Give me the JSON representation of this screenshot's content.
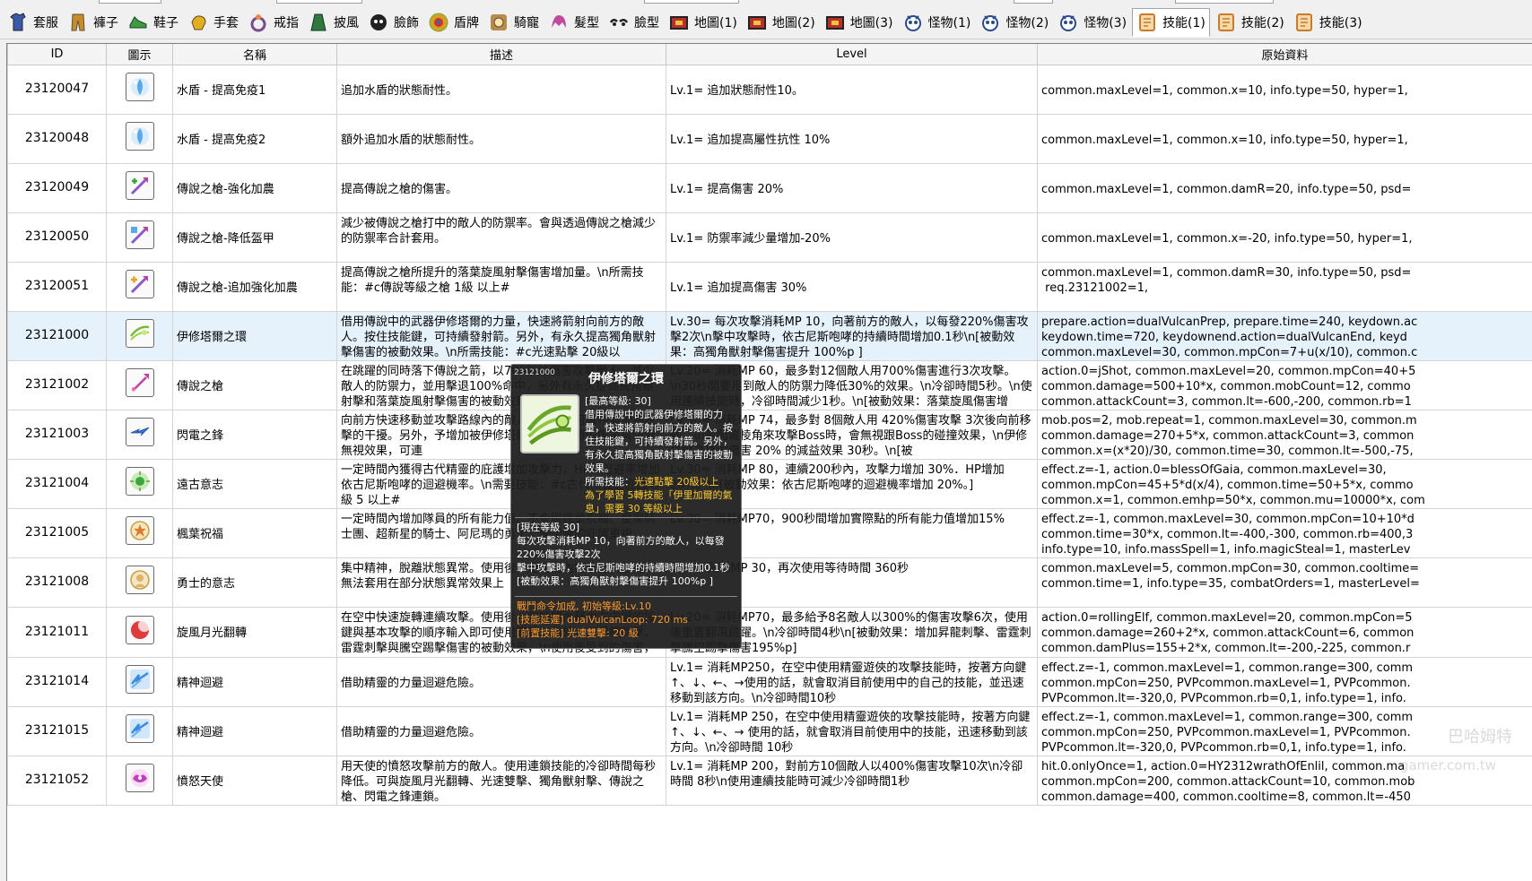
{
  "tabs": [
    {
      "label": "套服",
      "icon": "outfit-icon",
      "color": "#3a5aa8"
    },
    {
      "label": "褲子",
      "icon": "pants-icon",
      "color": "#c98b2a"
    },
    {
      "label": "鞋子",
      "icon": "shoes-icon",
      "color": "#3f9a3a"
    },
    {
      "label": "手套",
      "icon": "gloves-icon",
      "color": "#e0b020"
    },
    {
      "label": "戒指",
      "icon": "ring-icon",
      "color": "#7a4a8c"
    },
    {
      "label": "披風",
      "icon": "cape-icon",
      "color": "#2e7a3e"
    },
    {
      "label": "臉飾",
      "icon": "face-accessory-icon",
      "color": "#222222"
    },
    {
      "label": "盾牌",
      "icon": "shield-icon",
      "color": "#d4a020"
    },
    {
      "label": "騎寵",
      "icon": "mount-icon",
      "color": "#b78c4a"
    },
    {
      "label": "髮型",
      "icon": "hair-icon",
      "color": "#c04aa0"
    },
    {
      "label": "臉型",
      "icon": "face-icon",
      "color": "#222222"
    },
    {
      "label": "地圖(1)",
      "icon": "map-icon",
      "color": "#b8302a"
    },
    {
      "label": "地圖(2)",
      "icon": "map-icon",
      "color": "#b8302a"
    },
    {
      "label": "地圖(3)",
      "icon": "map-icon",
      "color": "#b8302a"
    },
    {
      "label": "怪物(1)",
      "icon": "monster-icon",
      "color": "#2a4a8c"
    },
    {
      "label": "怪物(2)",
      "icon": "monster-icon",
      "color": "#2a4a8c"
    },
    {
      "label": "怪物(3)",
      "icon": "monster-icon",
      "color": "#2a4a8c"
    },
    {
      "label": "技能(1)",
      "icon": "skill-book-icon",
      "color": "#c97a2a"
    },
    {
      "label": "技能(2)",
      "icon": "skill-book-icon",
      "color": "#c97a2a"
    },
    {
      "label": "技能(3)",
      "icon": "skill-book-icon",
      "color": "#c97a2a"
    }
  ],
  "active_tab": 17,
  "columns": [
    "ID",
    "圖示",
    "名稱",
    "描述",
    "Level",
    "原始資料"
  ],
  "rows": [
    {
      "id": "23120047",
      "icon": "water-shield-icon",
      "color": "#5aa8e8",
      "name": "水盾 - 提高免疫1",
      "desc": "追加水盾的狀態耐性。",
      "level": "Lv.1= 追加狀態耐性10。",
      "raw": "common.maxLevel=1, common.x=10, info.type=50, hyper=1,"
    },
    {
      "id": "23120048",
      "icon": "water-shield-icon",
      "color": "#5aa8e8",
      "name": "水盾 - 提高免疫2",
      "desc": "額外追加水盾的狀態耐性。",
      "level": "Lv.1= 追加提高屬性抗性 10%",
      "raw": "common.maxLevel=1, common.x=10, info.type=50, hyper=1,"
    },
    {
      "id": "23120049",
      "icon": "spear-enhance-icon",
      "color": "#8a5ac8",
      "name": "傳說之槍-強化加農",
      "desc": "提高傳說之槍的傷害。",
      "level": "Lv.1= 提高傷害 20%",
      "raw": "common.maxLevel=1, common.damR=20, info.type=50, psd="
    },
    {
      "id": "23120050",
      "icon": "spear-defense-icon",
      "color": "#8a5ac8",
      "name": "傳說之槍-降低盔甲",
      "desc": "減少被傳說之槍打中的敵人的防禦率。會與透過傳說之槍減少的防禦率合計套用。",
      "level": "Lv.1= 防禦率減少量增加-20%",
      "raw": "common.maxLevel=1, common.x=-20, info.type=50, hyper=1,"
    },
    {
      "id": "23120051",
      "icon": "spear-reinforce-icon",
      "color": "#8a5ac8",
      "name": "傳說之槍-追加強化加農",
      "desc": "提高傳說之槍所提升的落葉旋風射擊傷害增加量。\\n所需技能：#c傳說等級之槍 1級 以上#",
      "level": "Lv.1= 追加提高傷害 30%",
      "raw": "common.maxLevel=1, common.damR=30, info.type=50, psd=\n req.23121002=1,"
    },
    {
      "id": "23121000",
      "icon": "ishtar-ring-icon",
      "color": "#7ab838",
      "name": "伊修塔爾之環",
      "selected": true,
      "desc": "借用傳說中的武器伊修塔爾的力量，快速將箭射向前方的敵人。按住技能鍵，可持續發射箭。另外，有永久提高獨角獸射擊傷害的被動效果。\\n所需技能：#c光速點擊 20級以",
      "level": "Lv.30= 每次攻擊消耗MP 10，向著前方的敵人，以每發220%傷害攻擊2次\\n擊中攻擊時，依古尼斯咆哮的持續時間增加0.1秒\\n[被動效果：高獨角獸射擊傷害提升 100%p ]",
      "raw": "prepare.action=dualVulcanPrep, prepare.time=240, keydown.ac\nkeydown.time=720, keydownend.action=dualVulcanEnd, keyd\ncommon.maxLevel=30, common.mpCon=7+u(x/10), common.c"
    },
    {
      "id": "23121002",
      "icon": "legendary-spear-icon",
      "color": "#c040a0",
      "name": "傳說之槍",
      "desc": "在跳躍的同時落下傳說之箭，以700%的傷害攻擊敵人，減少敵人的防禦力，並用擊退100%命中，另外有永久提高獨角獸射擊和落葉旋風射擊傷害的被動效果，可連",
      "level": "Lv.20= 消耗MP 60，最多對12個敵人用700%傷害進行3次攻擊。\\n30秒間要用到敵人的防禦力降低30%的效果。\\n冷卻時間5秒。\\n使用連續技能時，冷卻時間減少1秒。\\n[被動效果：落葉旋風傷害增",
      "raw": "action.0=jShot, common.maxLevel=20, common.mpCon=40+5\ncommon.damage=500+10*x, common.mobCount=12, commo\ncommon.attackCount=3, common.lt=-600,-200, common.rb=1"
    },
    {
      "id": "23121003",
      "icon": "lightning-edge-icon",
      "color": "#3a7ae0",
      "name": "閃電之鋒",
      "desc": "向前方快速移動並攻擊路線內的敵人，移動時可無視與受到攻擊的干擾。另外，予增加被伊修塔爾之戒攻擊時的傷害與防禦無視效果，可連",
      "level": "Lv.30= 消耗MP 74，最多對 8個敵人用 420%傷害攻擊 3次後向前移動。\\n若閃電棱角來攻擊Boss時，會無視跟Boss的碰撞效果，\\n伊修塔爾之環的傷害 20% 的減益效果 30秒。\\n[被",
      "raw": "mob.pos=2, mob.repeat=1, common.maxLevel=30, common.m\ncommon.damage=270+5*x, common.attackCount=3, common\ncommon.x=(x*20)/30, common.time=30, common.lt=-500,-75,"
    },
    {
      "id": "23121004",
      "icon": "ancient-spirit-icon",
      "color": "#3aa83a",
      "name": "遠古意志",
      "desc": "一定時間內獲得古代精靈的庇護增加攻擊力，HP與迴避率增加依古尼斯咆哮的迴避機率。\\n需要技能：#c古代精靈的庇護等級 5 以上#",
      "level": "Lv.30= 消耗MP 80，連續200秒內，攻擊力增加 30%．HP增加 20%。\\n[被動效果：依古尼斯咆哮的迴避機率增加 20%。]",
      "raw": "effect.z=-1, action.0=blessOfGaia, common.maxLevel=30,\ncommon.mpCon=45+5*d(x/4), common.time=50+5*x, commo\ncommon.x=1, common.emhp=50*x, common.mu=10000*x, com"
    },
    {
      "id": "23121005",
      "icon": "maple-blessing-icon",
      "color": "#c8a040",
      "name": "楓葉祝福",
      "desc": "一定時間內增加隊員的所有能力值。不會跟楓葉祝福、皇家騎士團、超新星的騎士、阿尼瑪的勇士、優伊娜的庇護重複",
      "level": "Lv.30= 消耗MP70，900秒間增加實際點的所有能力值增加15%",
      "raw": "effect.z=-1, common.maxLevel=30, common.mpCon=10+10*d\ncommon.time=30*x, common.lt=-400,-300, common.rb=400,3\ninfo.type=10, info.massSpell=1, info.magicSteal=1, masterLev"
    },
    {
      "id": "23121008",
      "icon": "hero-will-icon",
      "color": "#c8a040",
      "name": "勇士的意志",
      "desc": "集中精神，脫離狀態異常。使用後一定時間內無法再次使用。無法套用在部分狀態異常效果上",
      "level": "Lv.5= 消耗MP 30，再次使用等待時間 360秒",
      "raw": "common.maxLevel=5, common.mpCon=30, common.cooltime=\ncommon.time=1, info.type=35, combatOrders=1, masterLevel="
    },
    {
      "id": "23121011",
      "icon": "rolling-moon-icon",
      "color": "#e03a3a",
      "name": "旋風月光翻轉",
      "desc": "在空中快速旋轉連續攻擊。使用後一定時間內藉由方向鍵的按鍵與基本攻擊的順序輸入即可使用連擊。另外，使昇龍刺擊、雷霆刺擊與騰空踢擊傷害的被動效果，\\n使用後受到的傷害，並用",
      "level": "Lv.20= 消耗MP70，最多給予8名敵人以300%的傷害攻擊6次，使用後重置翻滾跳躍。\\n冷卻時間4秒\\n[被動效果：增加昇龍刺擊、雷霆刺擊騰空踢擊傷害195%p]",
      "raw": "action.0=rollingElf, common.maxLevel=20, common.mpCon=5\ncommon.damage=260+2*x, common.attackCount=6, common\ncommon.damPlus=155+2*x, common.lt=-200,-225, common.r"
    },
    {
      "id": "23121014",
      "icon": "spirit-dodge-icon",
      "color": "#3a8ae0",
      "name": "精神迴避",
      "desc": "借助精靈的力量迴避危險。",
      "level": "Lv.1= 消耗MP250，在空中使用精靈遊俠的攻擊技能時，按著方向鍵↑、↓、←、→使用的話，就會取消目前使用中的自己的技能，並迅速移動到該方向。\\n冷卻時間10秒",
      "raw": "effect.z=-1, common.maxLevel=1, common.range=300, comm\ncommon.mpCon=250, PVPcommon.maxLevel=1, PVPcommon.\nPVPcommon.lt=-320,0, PVPcommon.rb=0,1, info.type=1, info."
    },
    {
      "id": "23121015",
      "icon": "spirit-dodge-icon",
      "color": "#3a8ae0",
      "name": "精神迴避",
      "desc": "借助精靈的力量迴避危險。",
      "level": "Lv.1= 消耗MP 250，在空中使用精靈遊俠的攻擊技能時，按著方向鍵↑、↓、←、→ 使用的話，就會取消目前使用中的技能，迅速移動到該方向。\\n冷卻時間 10秒",
      "raw": "effect.z=-1, common.maxLevel=1, common.range=300, comm\ncommon.mpCon=250, PVPcommon.maxLevel=1, PVPcommon.\nPVPcommon.lt=-320,0, PVPcommon.rb=0,1, info.type=1, info."
    },
    {
      "id": "23121052",
      "icon": "wrath-angel-icon",
      "color": "#c040c0",
      "name": "憤怒天使",
      "desc": "用天使的憤怒攻擊前方的敵人。使用連鎖技能的冷卻時間每秒降低。可與旋風月光翻轉、光速雙擊、獨角獸射擊、傳說之槍、閃電之鋒連鎖。",
      "level": "Lv.1= 消耗MP 200，對前方10個敵人以400%傷害攻擊10次\\n冷卻時間 8秒\\n使用連續技能時可減少冷卻時間1秒",
      "raw": "hit.0.onlyOnce=1, action.0=HY2312wrathOfEnlil, common.ma\ncommon.mpCon=200, common.attackCount=10, common.mob\ncommon.damage=400, common.cooltime=8, common.lt=-450"
    }
  ],
  "tooltip": {
    "id": "23121000",
    "name": "伊修塔爾之環",
    "max_level": "[最高等級: 30]",
    "desc": "借用傳說中的武器伊修塔爾的力量，快速將箭射向前方的敵人。按住技能鍵，可持續發射箭。另外，有永久提高獨角獸射擊傷害的被動效果。",
    "req_label": "所需技能：",
    "req_skill": "光速點擊 20級以上",
    "req_note": "為了學習 5轉技能「伊里加爾的氣息」需要 30 等級以上",
    "current_level": "[現在等級 30]",
    "current_effect": "每次攻擊消耗MP 10，向著前方的敵人，以每發220%傷害攻擊2次\n擊中攻擊時，依古尼斯咆哮的持續時間增加0.1秒\n[被動效果：高獨角獸射擊傷害提升 100%p ]",
    "extra_1": "戰鬥命令加成, 初始等級:Lv.10",
    "extra_2": "[技能延遲] dualVulcanLoop: 720 ms",
    "extra_3": "[前置技能] 光速雙擊: 20 級"
  },
  "watermark": "巴哈姆特",
  "watermark_sub": "gamer.com.tw"
}
